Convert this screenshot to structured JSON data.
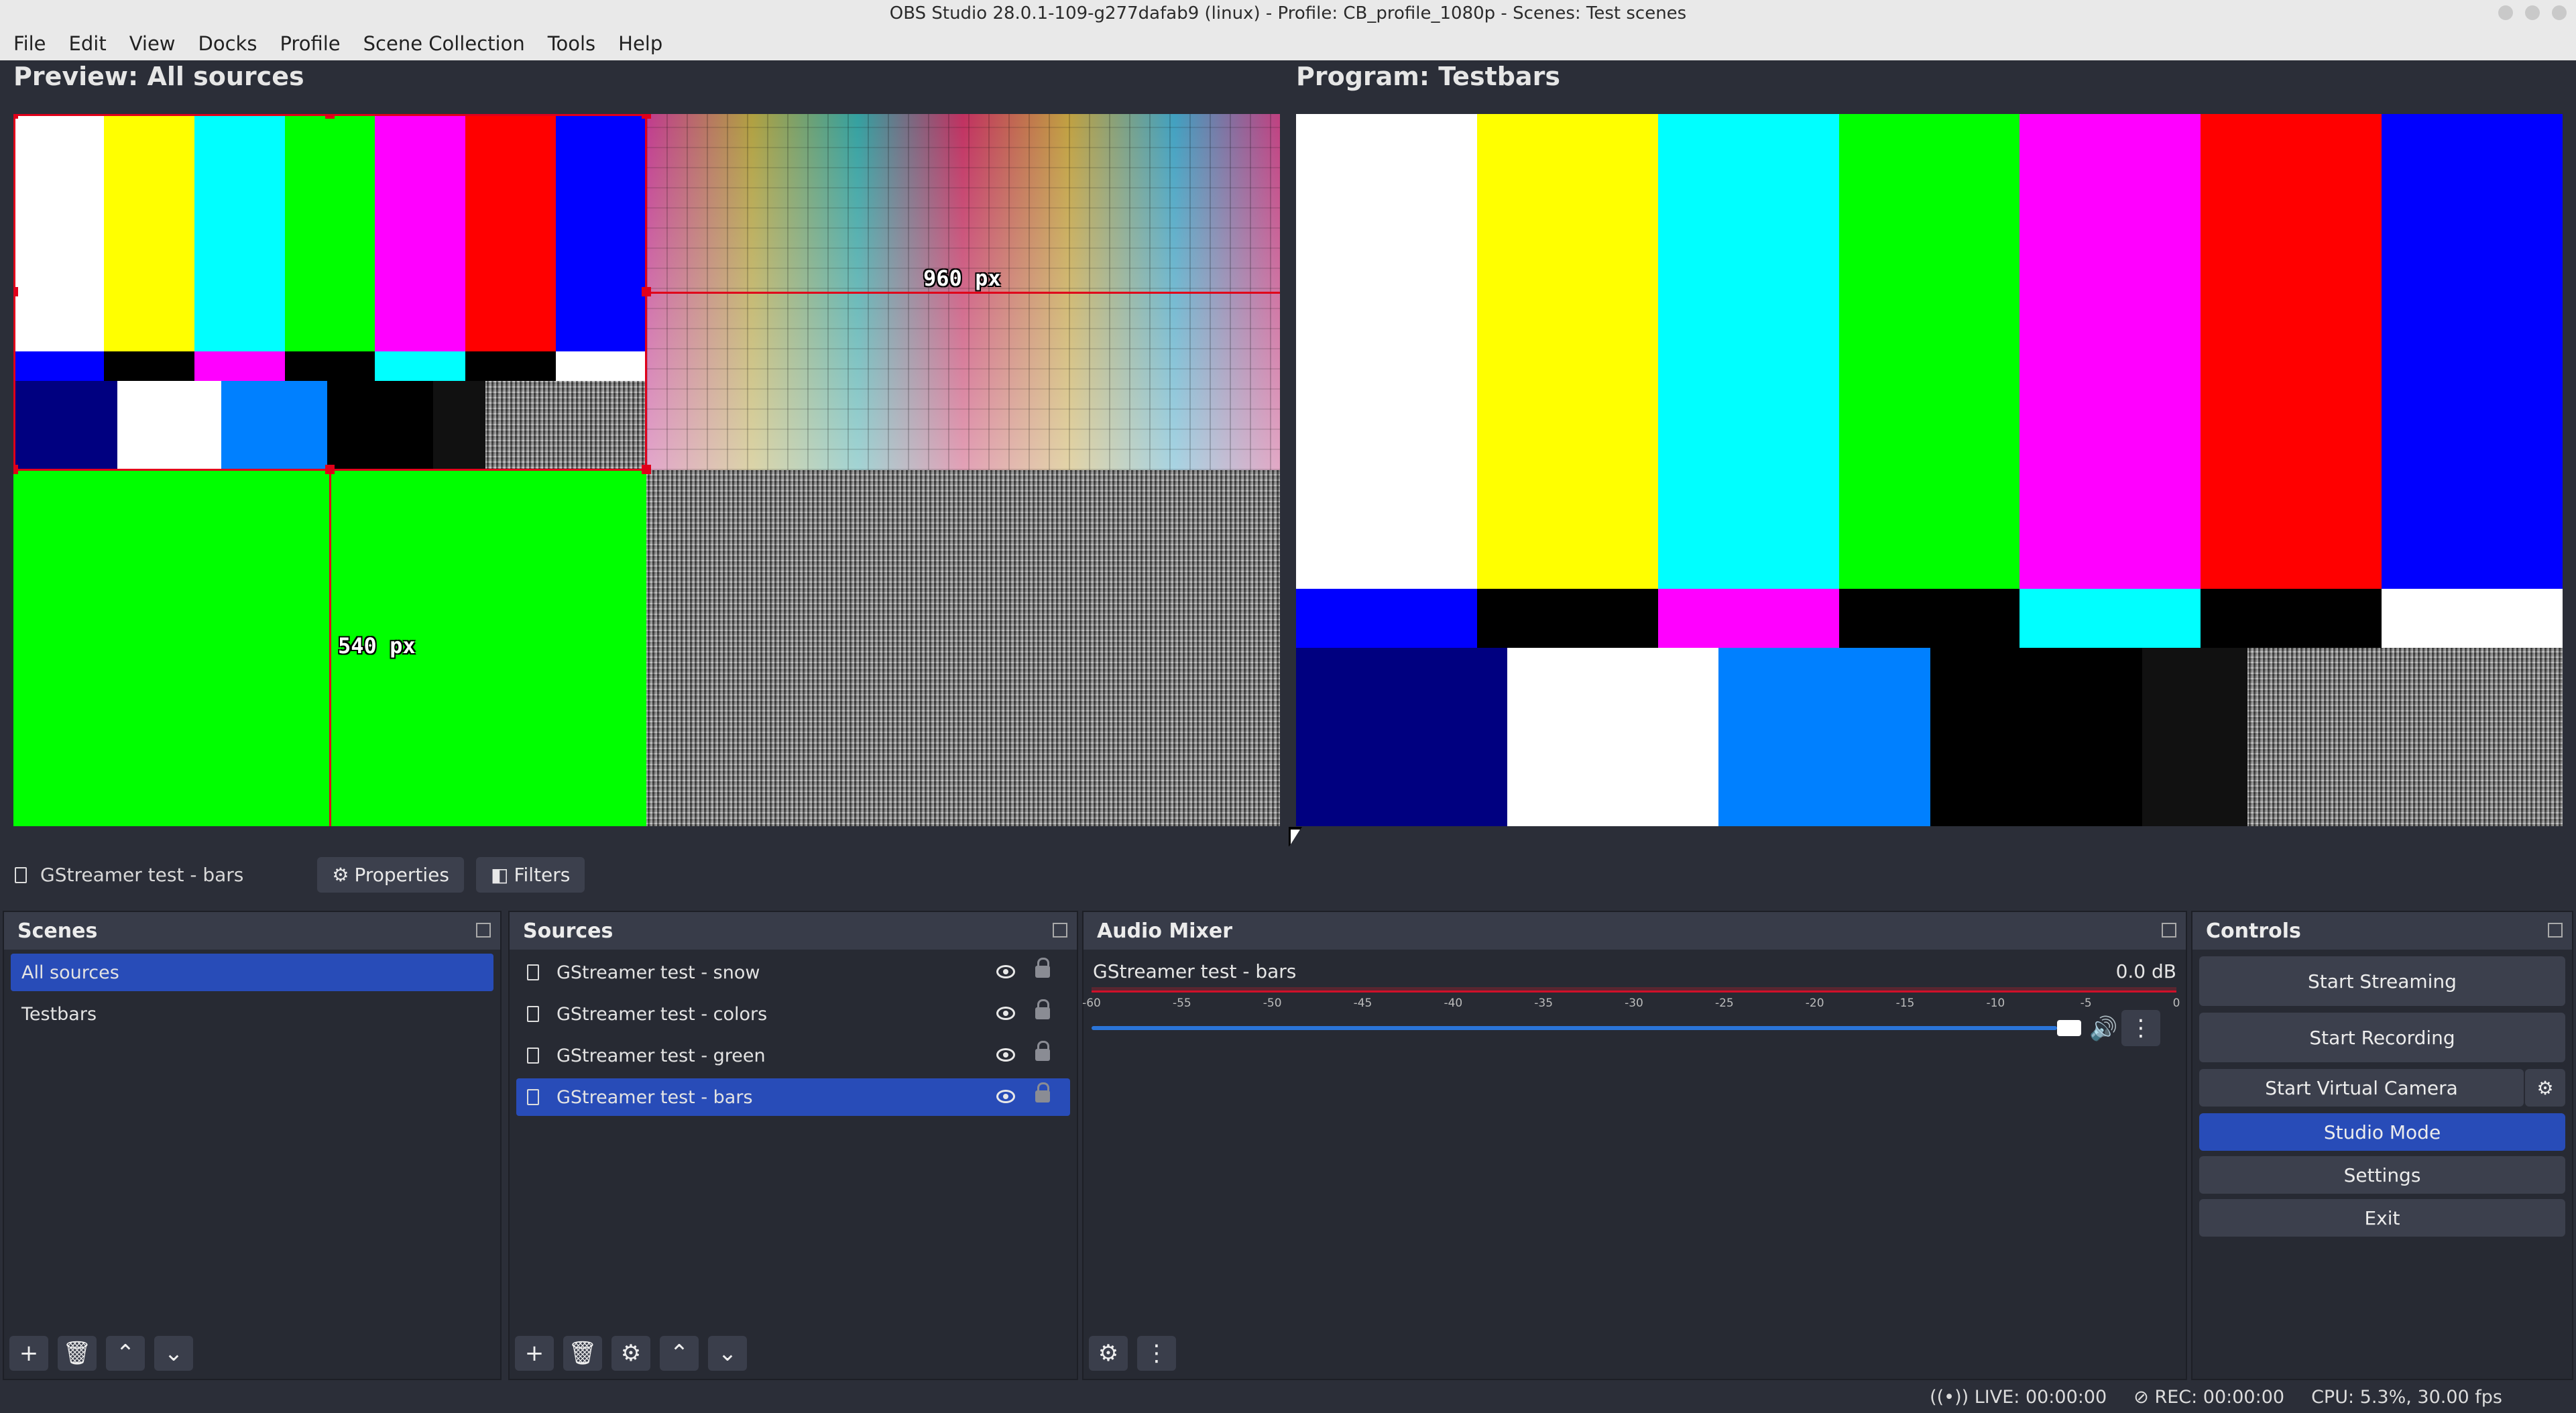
{
  "window": {
    "title": "OBS Studio 28.0.1-109-g277dafab9 (linux) - Profile: CB_profile_1080p - Scenes: Test scenes"
  },
  "menu": [
    "File",
    "Edit",
    "View",
    "Docks",
    "Profile",
    "Scene Collection",
    "Tools",
    "Help"
  ],
  "preview": {
    "title": "Preview: All sources",
    "width_label": "960 px",
    "height_label": "540 px"
  },
  "program": {
    "title": "Program: Testbars"
  },
  "colors": {
    "bar_white": "#ffffff",
    "bar_yellow": "#ffff00",
    "bar_cyan": "#00ffff",
    "bar_green": "#00ff00",
    "bar_magenta": "#ff00ff",
    "bar_red": "#ff0000",
    "bar_blue": "#0000ff",
    "selection": "#e0001a",
    "accent": "#284cb8"
  },
  "selected_source": {
    "name": "GStreamer test - bars",
    "properties_label": "Properties",
    "filters_label": "Filters"
  },
  "scenes": {
    "title": "Scenes",
    "items": [
      "All sources",
      "Testbars"
    ],
    "selected": "All sources"
  },
  "sources": {
    "title": "Sources",
    "items": [
      "GStreamer test - snow",
      "GStreamer test - colors",
      "GStreamer test - green",
      "GStreamer test - bars"
    ],
    "selected": "GStreamer test - bars"
  },
  "mixer": {
    "title": "Audio Mixer",
    "channel_name": "GStreamer test - bars",
    "level": "0.0 dB",
    "scale": [
      "-60",
      "-55",
      "-50",
      "-45",
      "-40",
      "-35",
      "-30",
      "-25",
      "-20",
      "-15",
      "-10",
      "-5",
      "0"
    ],
    "volume_fraction": 0.93
  },
  "controls": {
    "title": "Controls",
    "start_streaming": "Start Streaming",
    "start_recording": "Start Recording",
    "start_virtual_camera": "Start Virtual Camera",
    "studio_mode": "Studio Mode",
    "settings": "Settings",
    "exit": "Exit"
  },
  "status": {
    "live": "LIVE: 00:00:00",
    "rec": "REC: 00:00:00",
    "cpu": "CPU: 5.3%, 30.00 fps"
  }
}
